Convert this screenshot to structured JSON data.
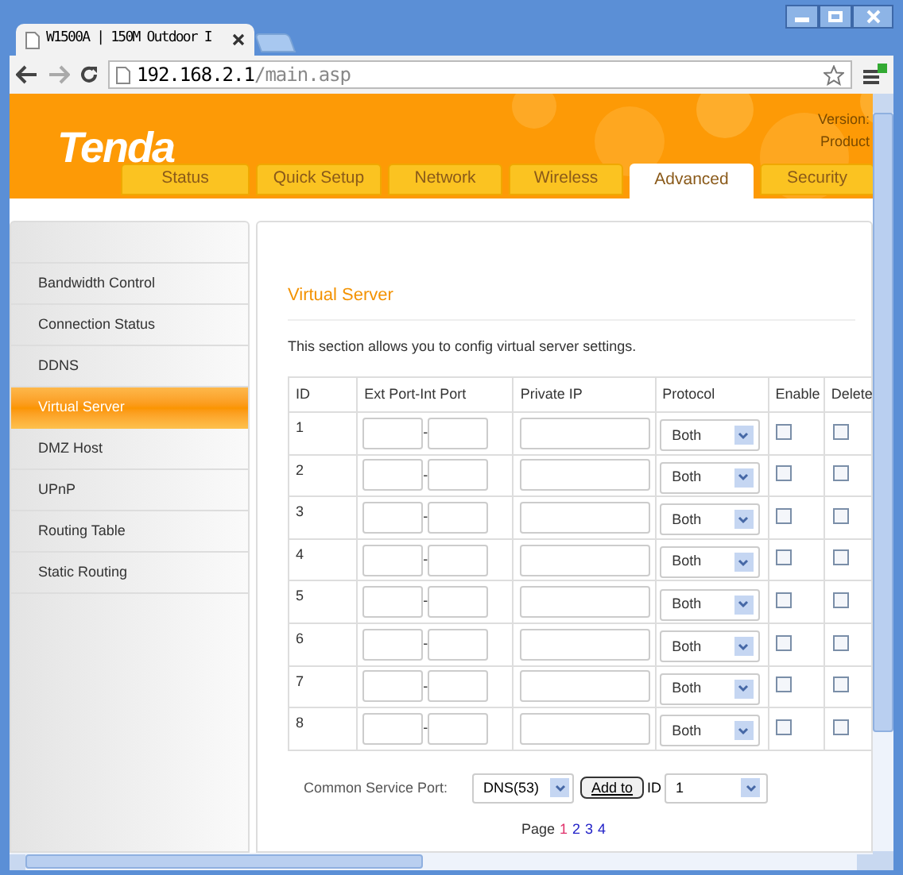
{
  "browser": {
    "tab_title": "W1500A | 150M Outdoor I",
    "url_host": "192.168.2.1",
    "url_path": "/main.asp"
  },
  "header": {
    "logo": "Tenda",
    "version_label": "Version:",
    "product_label": "Product",
    "nav_tabs": [
      {
        "label": "Status",
        "selected": false
      },
      {
        "label": "Quick Setup",
        "selected": false
      },
      {
        "label": "Network",
        "selected": false
      },
      {
        "label": "Wireless",
        "selected": false
      },
      {
        "label": "Advanced",
        "selected": true
      },
      {
        "label": "Security",
        "selected": false
      }
    ]
  },
  "sidebar": {
    "items": [
      {
        "label": "Bandwidth Control",
        "selected": false
      },
      {
        "label": "Connection Status",
        "selected": false
      },
      {
        "label": "DDNS",
        "selected": false
      },
      {
        "label": "Virtual Server",
        "selected": true
      },
      {
        "label": "DMZ Host",
        "selected": false
      },
      {
        "label": "UPnP",
        "selected": false
      },
      {
        "label": "Routing Table",
        "selected": false
      },
      {
        "label": "Static Routing",
        "selected": false
      }
    ]
  },
  "content": {
    "title": "Virtual Server",
    "description": "This section allows you to config virtual server settings.",
    "table": {
      "columns": [
        "ID",
        "Ext Port-Int Port",
        "Private IP",
        "Protocol",
        "Enable",
        "Delete"
      ],
      "rows": [
        {
          "id": "1",
          "separator": "-",
          "protocol": "Both",
          "enabled": false,
          "delete": false
        },
        {
          "id": "2",
          "separator": "-",
          "protocol": "Both",
          "enabled": false,
          "delete": false
        },
        {
          "id": "3",
          "separator": "-",
          "protocol": "Both",
          "enabled": false,
          "delete": false
        },
        {
          "id": "4",
          "separator": "-",
          "protocol": "Both",
          "enabled": false,
          "delete": false
        },
        {
          "id": "5",
          "separator": "-",
          "protocol": "Both",
          "enabled": false,
          "delete": false
        },
        {
          "id": "6",
          "separator": "-",
          "protocol": "Both",
          "enabled": false,
          "delete": false
        },
        {
          "id": "7",
          "separator": "-",
          "protocol": "Both",
          "enabled": false,
          "delete": false
        },
        {
          "id": "8",
          "separator": "-",
          "protocol": "Both",
          "enabled": false,
          "delete": false
        }
      ]
    },
    "common_service": {
      "label": "Common Service Port:",
      "service": "DNS(53)",
      "button": "Add to",
      "id_label": "ID",
      "id_value": "1"
    },
    "pagination": {
      "label": "Page",
      "pages": [
        {
          "label": "1",
          "selected": true
        },
        {
          "label": "2",
          "selected": false
        },
        {
          "label": "3",
          "selected": false
        },
        {
          "label": "4",
          "selected": false
        }
      ]
    }
  }
}
